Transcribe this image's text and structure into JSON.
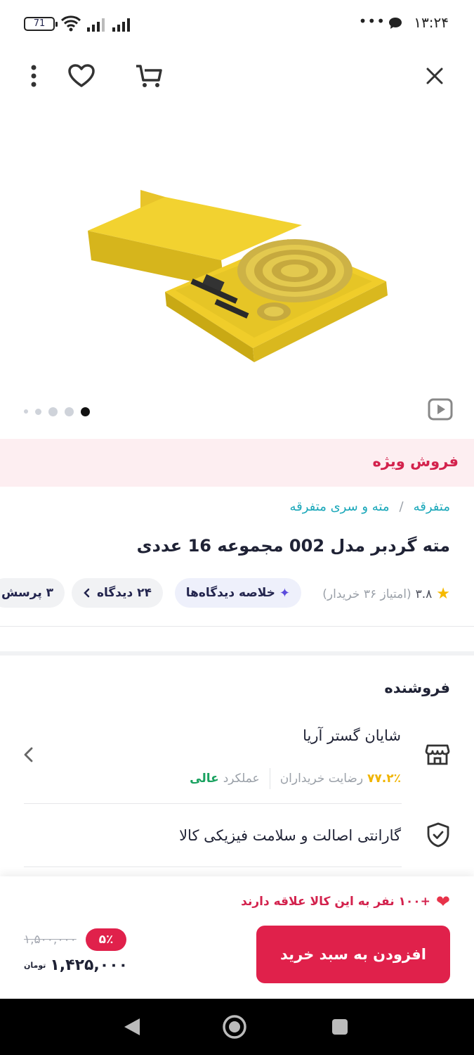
{
  "status_bar": {
    "time": "۱۳:۲۴",
    "more_dots": "•••",
    "battery": "71"
  },
  "top_bar": {
    "icons": [
      "close-icon",
      "cart-icon",
      "heart-icon",
      "more-vertical-icon"
    ]
  },
  "gallery": {
    "dots_count": 5,
    "active_dot": 5,
    "image_alt": "hole saw set in yellow case"
  },
  "special_sale": {
    "label": "فروش ویژه"
  },
  "breadcrumb": {
    "items": [
      "متفرقه",
      "مته و سری متفرقه"
    ],
    "separator": "/"
  },
  "product": {
    "title": "مته گردبر مدل 002 مجموعه 16 عددی",
    "rating": "۳.۸",
    "rating_note": "(امتیاز ۳۶ خریدار)",
    "summary_chip": "خلاصه دیدگاه‌ها",
    "reviews_chip": "۲۴ دیدگاه",
    "questions_chip": "۳ پرسش"
  },
  "seller": {
    "heading": "فروشنده",
    "name": "شایان گستر آریا",
    "satisfaction_pct": "۷۷.۲٪",
    "satisfaction_label": "رضایت خریداران",
    "performance_label": "عملکرد",
    "performance_value": "عالی"
  },
  "warranty": {
    "text": "گارانتی اصالت و سلامت فیزیکی کالا"
  },
  "purchase": {
    "interest_text": "+۱۰۰ نفر به این کالا علاقه دارند",
    "add_to_cart": "افزودن به سبد خرید",
    "old_price": "۱,۵۰۰,۰۰۰",
    "discount": "۵٪",
    "price": "۱,۴۲۵,۰۰۰",
    "currency": "تومان"
  },
  "colors": {
    "accent": "#e0214b",
    "link": "#19a7b9",
    "star": "#f6b900",
    "excellent": "#1aa260"
  }
}
